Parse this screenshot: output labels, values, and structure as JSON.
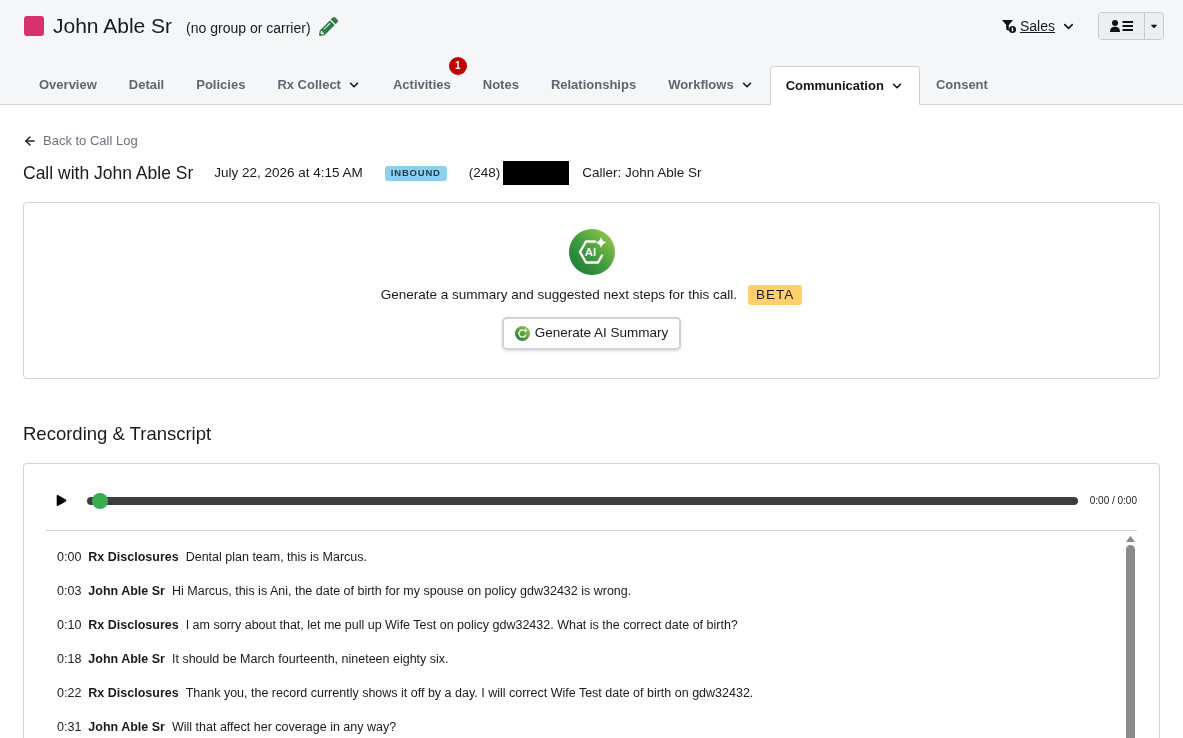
{
  "header": {
    "name": "John Able Sr",
    "subtitle": "(no group or carrier)",
    "filter": {
      "label": "Sales"
    }
  },
  "tabs": [
    {
      "label": "Overview",
      "selected": false,
      "has_menu": false
    },
    {
      "label": "Detail",
      "selected": false,
      "has_menu": false
    },
    {
      "label": "Policies",
      "selected": false,
      "has_menu": false
    },
    {
      "label": "Rx Collect",
      "selected": false,
      "has_menu": true
    },
    {
      "label": "Activities",
      "selected": false,
      "has_menu": false,
      "badge": "1"
    },
    {
      "label": "Notes",
      "selected": false,
      "has_menu": false
    },
    {
      "label": "Relationships",
      "selected": false,
      "has_menu": false
    },
    {
      "label": "Workflows",
      "selected": false,
      "has_menu": true
    },
    {
      "label": "Communication",
      "selected": true,
      "has_menu": true
    },
    {
      "label": "Consent",
      "selected": false,
      "has_menu": false
    }
  ],
  "back_link": "Back to Call Log",
  "call": {
    "title": "Call with John Able Sr",
    "datetime": "July 22, 2026 at 4:15 AM",
    "direction": "INBOUND",
    "area_code": "(248)",
    "number_redacted": true,
    "caller": "Caller: John Able Sr"
  },
  "ai_summary": {
    "logo_text": "AI",
    "prompt": "Generate a summary and suggested next steps for this call.",
    "badge": "BETA",
    "button": "Generate AI Summary"
  },
  "recording": {
    "heading": "Recording & Transcript",
    "player": {
      "level": 0,
      "time": "0:00 / 0:00"
    },
    "transcript": [
      {
        "time": "0:00",
        "speaker": "Rx Disclosures",
        "text": "Dental plan team, this is Marcus."
      },
      {
        "time": "0:03",
        "speaker": "John Able Sr",
        "text": "Hi Marcus, this is Ani, the date of birth for my spouse on policy gdw32432 is wrong."
      },
      {
        "time": "0:10",
        "speaker": "Rx Disclosures",
        "text": "I am sorry about that, let me pull up Wife Test on policy gdw32432. What is the correct date of birth?"
      },
      {
        "time": "0:18",
        "speaker": "John Able Sr",
        "text": "It should be March fourteenth, nineteen eighty six."
      },
      {
        "time": "0:22",
        "speaker": "Rx Disclosures",
        "text": "Thank you, the record currently shows it off by a day. I will correct Wife Test date of birth on gdw32432."
      },
      {
        "time": "0:31",
        "speaker": "John Able Sr",
        "text": "Will that affect her coverage in any way?"
      }
    ]
  }
}
